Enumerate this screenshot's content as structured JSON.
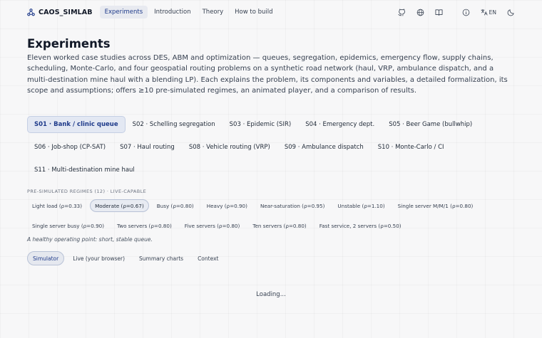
{
  "header": {
    "brand": "CAOS_SIMLAB",
    "nav": [
      "Experiments",
      "Introduction",
      "Theory",
      "How to build"
    ],
    "active_nav": 0,
    "lang": "EN",
    "icons": [
      "github-icon",
      "globe-icon",
      "book-icon",
      "info-icon",
      "translate-icon",
      "moon-icon"
    ]
  },
  "page": {
    "title": "Experiments",
    "intro": "Eleven worked case studies across DES, ABM and optimization — queues, segregation, epidemics, emergency flow, supply chains, scheduling, Monte-Carlo, and four geospatial routing problems on a synthetic road network (haul, VRP, ambulance dispatch, and a multi-destination mine haul with a blending LP). Each explains the problem, its components and variables, a detailed formalization, its scope and assumptions; offers ≥10 pre-simulated regimes, an animated player, and a comparison of results."
  },
  "cases": [
    "S01 · Bank / clinic queue",
    "S02 · Schelling segregation",
    "S03 · Epidemic (SIR)",
    "S04 · Emergency dept.",
    "S05 · Beer Game (bullwhip)",
    "S06 · Job-shop (CP-SAT)",
    "S07 · Haul routing",
    "S08 · Vehicle routing (VRP)",
    "S09 · Ambulance dispatch",
    "S10 · Monte-Carlo / CI",
    "S11 · Multi-destination mine haul"
  ],
  "active_case": 0,
  "regimes_title": "PRE-SIMULATED REGIMES (12) · LIVE-CAPABLE",
  "regimes": [
    "Light load (ρ=0.33)",
    "Moderate (ρ=0.67)",
    "Busy (ρ=0.80)",
    "Heavy (ρ=0.90)",
    "Near-saturation (ρ=0.95)",
    "Unstable (ρ=1.10)",
    "Single server M/M/1 (ρ=0.80)",
    "Single server busy (ρ=0.90)",
    "Two servers (ρ=0.80)",
    "Five servers (ρ=0.80)",
    "Ten servers (ρ=0.80)",
    "Fast service, 2 servers (ρ=0.50)"
  ],
  "active_regime": 1,
  "regime_description": "A healthy operating point: short, stable queue.",
  "tabs": [
    "Simulator",
    "Live (your browser)",
    "Summary charts",
    "Context"
  ],
  "active_tab": 0,
  "status": "Loading..."
}
